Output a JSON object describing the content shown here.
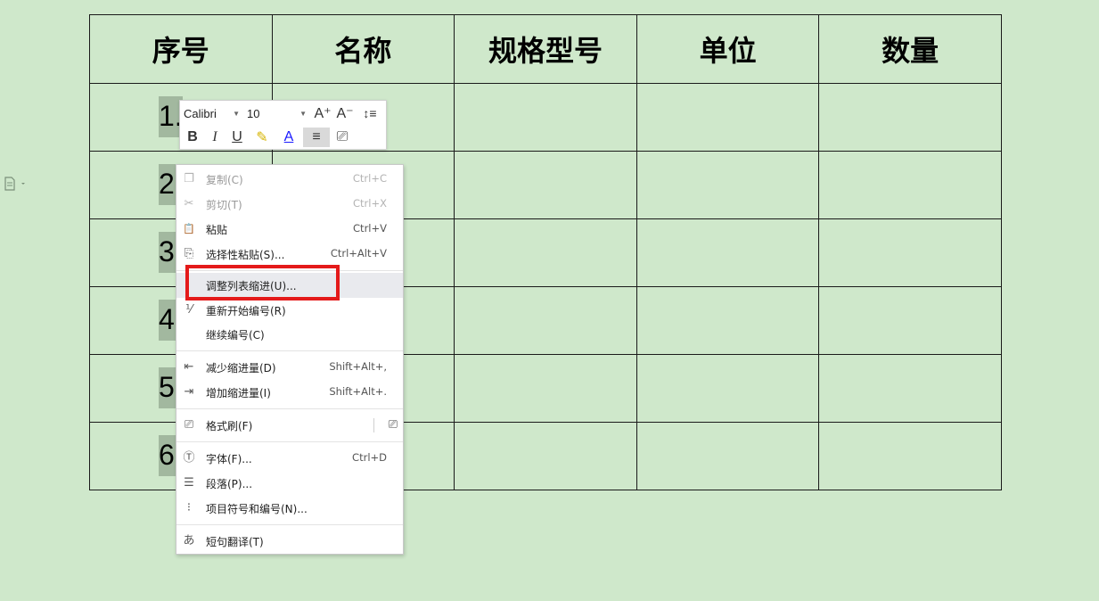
{
  "table": {
    "headers": [
      "序号",
      "名称",
      "规格型号",
      "单位",
      "数量"
    ],
    "row_numbers": [
      "1.",
      "2",
      "3",
      "4",
      "5",
      "6"
    ]
  },
  "toolbar": {
    "font_name": "Calibri",
    "font_size": "10",
    "grow_font": "A⁺",
    "shrink_font": "A⁻",
    "line_spacing": "↕≡",
    "bold": "B",
    "italic": "I",
    "underline": "U",
    "highlight": "✎",
    "font_color": "A",
    "align": "≡",
    "format_painter": "⎚"
  },
  "context_menu": {
    "items": [
      {
        "label": "复制(C)",
        "shortcut": "Ctrl+C",
        "icon": "copy-icon",
        "glyph": "❐"
      },
      {
        "label": "剪切(T)",
        "shortcut": "Ctrl+X",
        "icon": "cut-icon",
        "glyph": "✂"
      },
      {
        "label": "粘贴",
        "shortcut": "Ctrl+V",
        "icon": "paste-icon",
        "glyph": "📋"
      },
      {
        "label": "选择性粘贴(S)...",
        "shortcut": "Ctrl+Alt+V",
        "icon": "paste-special-icon",
        "glyph": "⎘"
      },
      {
        "label": "调整列表缩进(U)...",
        "shortcut": "",
        "icon": "",
        "glyph": ""
      },
      {
        "label": "重新开始编号(R)",
        "shortcut": "",
        "icon": "restart-numbering-icon",
        "glyph": "⅟"
      },
      {
        "label": "继续编号(C)",
        "shortcut": "",
        "icon": "",
        "glyph": ""
      },
      {
        "label": "减少缩进量(D)",
        "shortcut": "Shift+Alt+,",
        "icon": "decrease-indent-icon",
        "glyph": "⇤"
      },
      {
        "label": "增加缩进量(I)",
        "shortcut": "Shift+Alt+.",
        "icon": "increase-indent-icon",
        "glyph": "⇥"
      },
      {
        "label": "格式刷(F)",
        "shortcut": "",
        "icon": "format-painter-icon",
        "glyph": "⎚"
      },
      {
        "label": "字体(F)...",
        "shortcut": "Ctrl+D",
        "icon": "font-icon",
        "glyph": "Ⓣ"
      },
      {
        "label": "段落(P)...",
        "shortcut": "",
        "icon": "paragraph-icon",
        "glyph": "☰"
      },
      {
        "label": "项目符号和编号(N)...",
        "shortcut": "",
        "icon": "bullets-numbering-icon",
        "glyph": "⁝"
      },
      {
        "label": "短句翻译(T)",
        "shortcut": "",
        "icon": "translate-icon",
        "glyph": "あ"
      }
    ],
    "format_painter_extra_icon": "format-painter-lock-icon",
    "format_painter_extra_glyph": "⎚"
  },
  "colors": {
    "background": "#cfe8cb",
    "highlight_box": "#e41a1a",
    "cell_number_bg": "#a2b89f"
  }
}
